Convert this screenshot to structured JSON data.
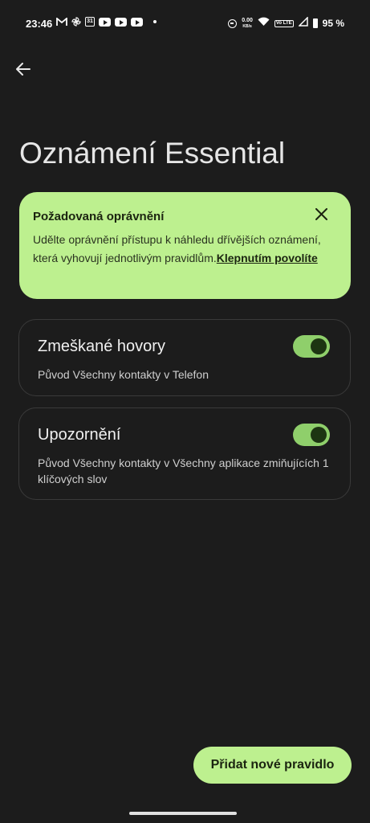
{
  "status_bar": {
    "time": "23:46",
    "net_speed_value": "0.00",
    "net_speed_unit": "KB/s",
    "volte": "Vo LTE",
    "battery_percent": "95 %",
    "calendar_day": "31",
    "icons": [
      "gmail-icon",
      "pinwheel-icon",
      "calendar-icon",
      "youtube-icon",
      "youtube-icon",
      "youtube-icon",
      "dot-icon",
      "do-not-disturb-icon",
      "wifi-icon",
      "signal-icon",
      "battery-icon"
    ]
  },
  "header": {
    "back_icon": "arrow-left-icon",
    "title": "Oznámení Essential"
  },
  "permission_card": {
    "title": "Požadovaná oprávnění",
    "body": "Udělte oprávnění přístupu k náhledu dřívějších oznámení, která vyhovují jednotlivým pravidlům.",
    "link": "Klepnutím povolíte",
    "close_icon": "close-icon",
    "background": "#bdf08f"
  },
  "rules": [
    {
      "title": "Zmeškané hovory",
      "subtitle": "Původ Všechny kontakty v Telefon",
      "enabled": true
    },
    {
      "title": "Upozornění",
      "subtitle": "Původ Všechny kontakty v Všechny aplikace zmiňujících 1 klíčových slov",
      "enabled": true
    }
  ],
  "fab": {
    "label": "Přidat nové pravidlo"
  },
  "colors": {
    "accent": "#bdf08f",
    "toggle_on": "#8fcf6b",
    "background": "#1c1c1c"
  }
}
